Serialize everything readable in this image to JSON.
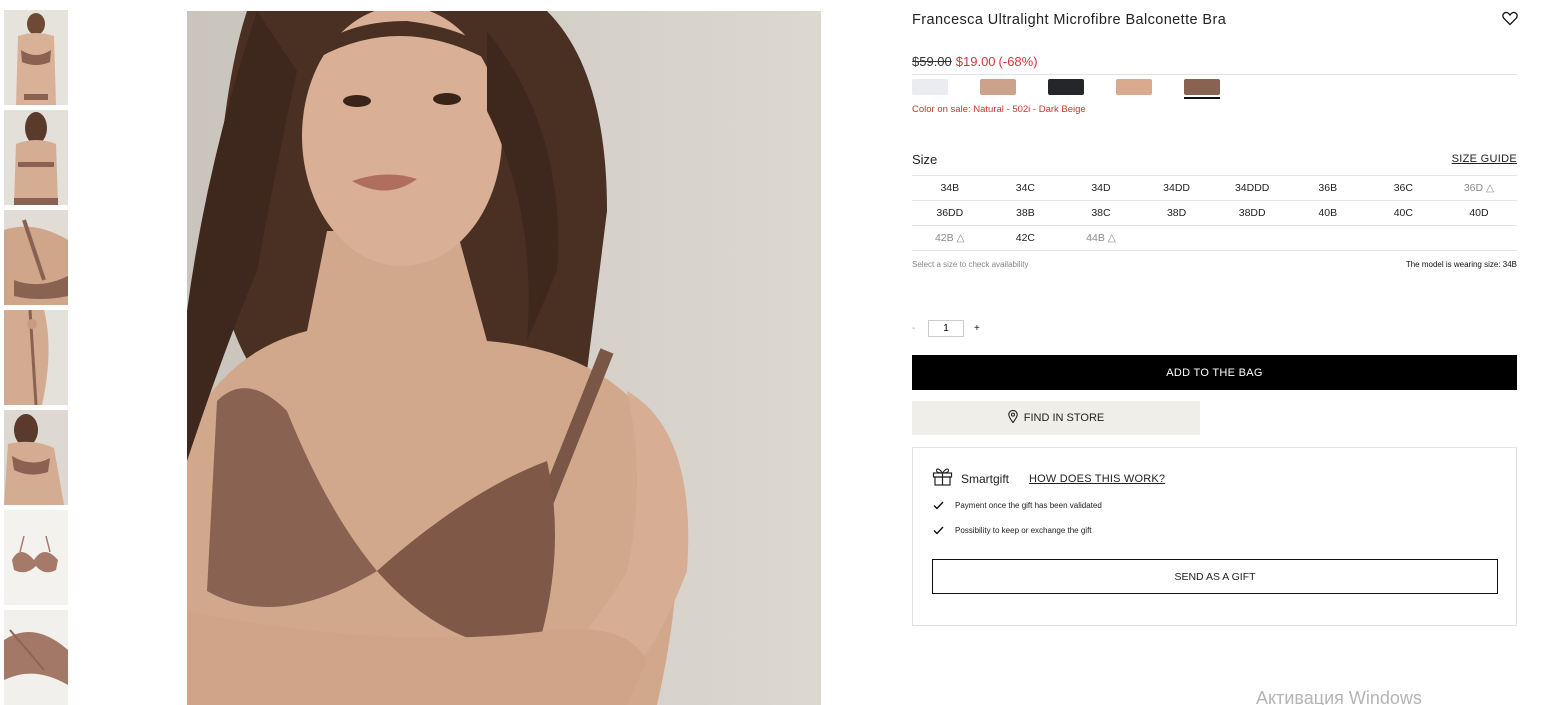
{
  "product": {
    "title": "Francesca Ultralight Microfibre Balconette Bra",
    "old_price": "$59.00",
    "new_price": "$19.00",
    "discount": "(-68%)",
    "color_note": "Color on sale: Natural - 502i - Dark Beige"
  },
  "swatches": [
    {
      "color": "#eaecf2",
      "selected": false
    },
    {
      "color": "#cda28c",
      "selected": false
    },
    {
      "color": "#25262a",
      "selected": false
    },
    {
      "color": "#d9aa8e",
      "selected": false
    },
    {
      "color": "#8a6252",
      "selected": true
    }
  ],
  "size": {
    "label": "Size",
    "guide_label": "SIZE GUIDE",
    "rows": [
      [
        "34B",
        "34C",
        "34D",
        "34DD",
        "34DDD",
        "36B",
        "36C",
        "36D △"
      ],
      [
        "36DD",
        "38B",
        "38C",
        "38D",
        "38DD",
        "40B",
        "40C",
        "40D"
      ],
      [
        "42B △",
        "42C",
        "44B △",
        "",
        "",
        "",
        "",
        ""
      ]
    ],
    "help": "Select a size to check availability",
    "model_note": "The model is wearing size: 34B"
  },
  "quantity": {
    "minus": "-",
    "value": "1",
    "plus": "+"
  },
  "buttons": {
    "add_to_bag": "ADD TO THE BAG",
    "find_in_store": "FIND IN STORE"
  },
  "smartgift": {
    "name": "Smartgift",
    "how_link": "HOW DOES THIS WORK?",
    "perks": [
      "Payment once the gift has been validated",
      "Possibility to keep or exchange the gift"
    ],
    "send_button": "SEND AS A GIFT"
  },
  "watermark": "Активация Windows",
  "icons": {
    "wishlist": "heart-icon",
    "store": "location-pin-icon",
    "gift": "gift-icon",
    "check": "check-icon"
  }
}
